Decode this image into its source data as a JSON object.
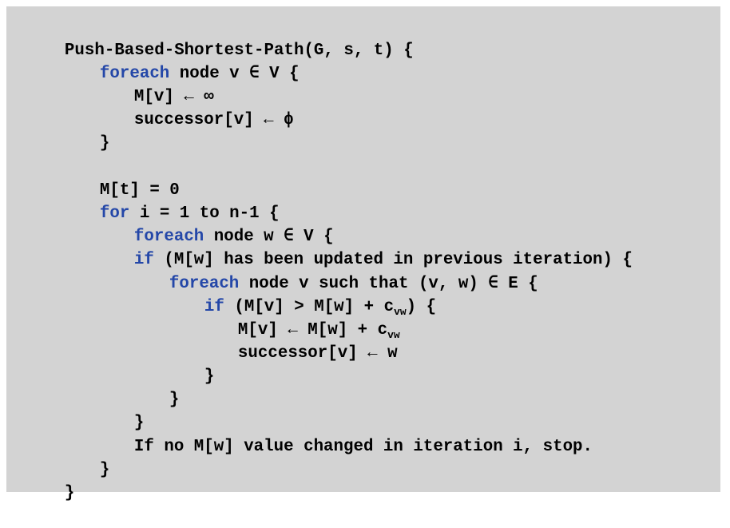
{
  "colors": {
    "background": "#d3d3d3",
    "text": "#000000",
    "keyword": "#2447a8"
  },
  "code": {
    "l1": "Push-Based-Shortest-Path(G, s, t) {",
    "l2_kw": "foreach",
    "l2": " node v ∈ V {",
    "l3": "M[v] ← ∞",
    "l4": "successor[v] ← ϕ",
    "l5": "}",
    "l6": "M[t] = 0",
    "l7_kw": "for",
    "l7": " i = 1 to n-1 {",
    "l8_kw": "foreach",
    "l8": " node w ∈ V {",
    "l9_kw": "if",
    "l9": " (M[w] has been updated in previous iteration) {",
    "l10_kw": "foreach",
    "l10": " node v such that (v, w) ∈ E {",
    "l11_kw": "if",
    "l11a": " (M[v] > M[w] + c",
    "l11_sub": "vw",
    "l11b": ") {",
    "l12a": "M[v] ← M[w] + c",
    "l12_sub": "vw",
    "l13": "successor[v] ← w",
    "l14": "}",
    "l15": "}",
    "l16": "}",
    "l17": "If no M[w] value changed in iteration i, stop.",
    "l18": "}",
    "l19": "}"
  }
}
